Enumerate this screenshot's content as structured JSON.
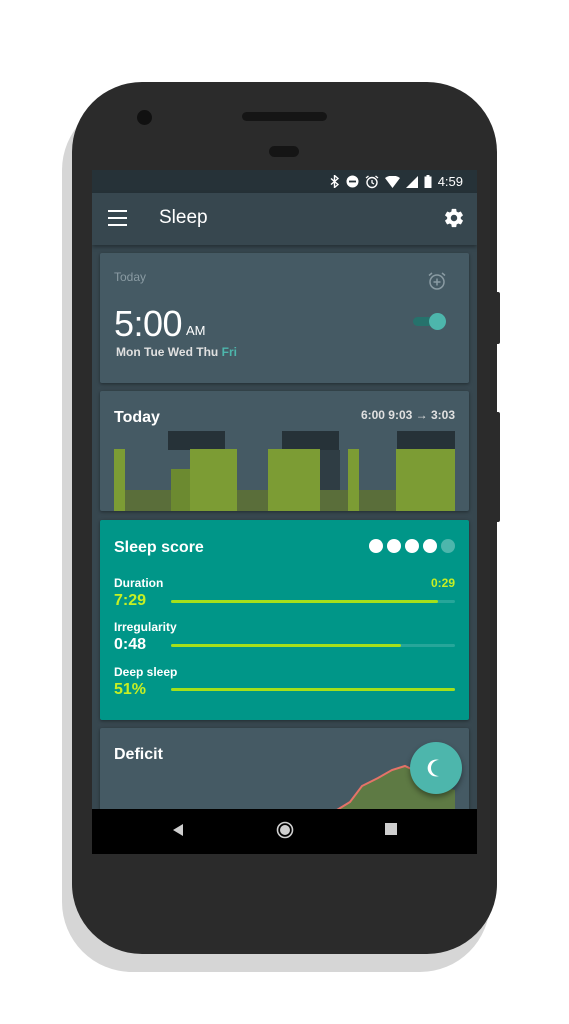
{
  "statusbar": {
    "icons": [
      "bluetooth-icon",
      "do-not-disturb-icon",
      "alarm-icon",
      "wifi-icon",
      "signal-icon",
      "battery-icon"
    ],
    "time": "4:59"
  },
  "appbar": {
    "title": "Sleep",
    "menu_icon": "menu-icon",
    "settings_icon": "gear-icon"
  },
  "alarm": {
    "label": "Today",
    "time": "5:00",
    "ampm": "AM",
    "days": [
      "Mon",
      "Tue",
      "Wed",
      "Thu"
    ],
    "active_day": "Fri",
    "enabled": true,
    "add_icon": "alarm-add-icon"
  },
  "today": {
    "title": "Today",
    "range": "6:00 9:03 → 3:03"
  },
  "score": {
    "title": "Sleep score",
    "rating": 4,
    "rating_max": 5,
    "metrics": [
      {
        "label": "Duration",
        "value": "7:29",
        "side": "0:29",
        "fill": 0.94,
        "color": "lime"
      },
      {
        "label": "Irregularity",
        "value": "0:48",
        "side": "",
        "fill": 0.81,
        "color": "white"
      },
      {
        "label": "Deep sleep",
        "value": "51%",
        "side": "",
        "fill": 1.0,
        "color": "lime"
      }
    ]
  },
  "deficit": {
    "title": "Deficit"
  },
  "fab": {
    "icon": "moon-icon"
  },
  "navbar": {
    "icons": [
      "back-icon",
      "home-icon",
      "recents-icon"
    ]
  },
  "colors": {
    "background": "#37474f",
    "card": "#455a64",
    "teal": "#009688",
    "accent": "#4db6ac",
    "lime": "#c6ef23",
    "sleep_bar": "#7c9c34"
  }
}
